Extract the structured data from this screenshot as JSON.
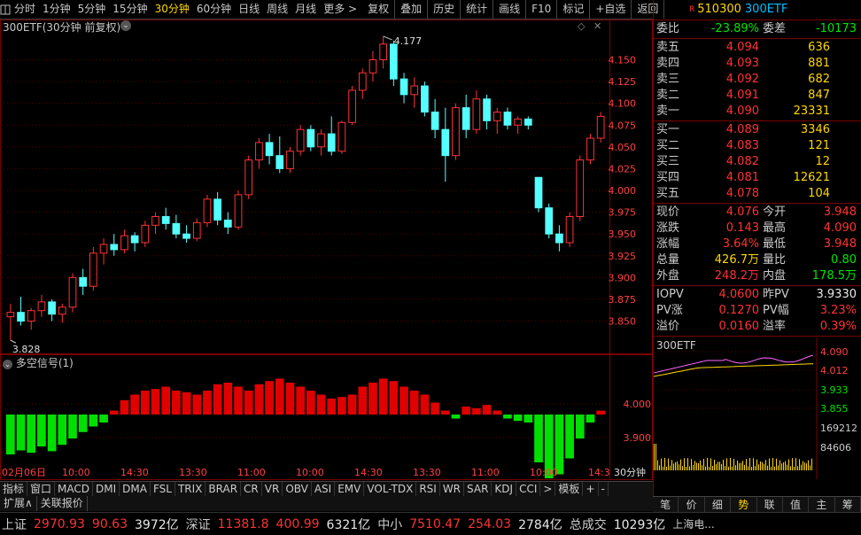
{
  "toolbar": {
    "periods": [
      "分时",
      "1分钟",
      "5分钟",
      "15分钟",
      "30分钟",
      "60分钟",
      "日线",
      "周线",
      "月线",
      "更多 >"
    ],
    "active_period": "30分钟",
    "tools": [
      "复权",
      "叠加",
      "历史",
      "统计",
      "画线",
      "F10",
      "标记",
      "+自选",
      "返回"
    ]
  },
  "chart": {
    "title": "300ETF(30分钟 前复权)",
    "high_label": "4.177",
    "low_label": "3.828",
    "price_ticks": [
      "4.150",
      "4.125",
      "4.100",
      "4.075",
      "4.050",
      "4.025",
      "4.000",
      "3.975",
      "3.950",
      "3.925",
      "3.900",
      "3.875",
      "3.850"
    ],
    "indicator_title": "多空信号(1)",
    "indicator_ticks": [
      "4.000",
      "3.900"
    ],
    "time_labels": [
      "02月06日",
      "10:00",
      "14:30",
      "13:30",
      "11:00",
      "10:00",
      "14:30",
      "13:30",
      "11:00",
      "10:00",
      "14:3"
    ],
    "period_label": "30分钟"
  },
  "quote": {
    "code": "510300",
    "name": "300ETF",
    "wei_bi_label": "委比",
    "wei_bi": "-23.89%",
    "wei_cha_label": "委差",
    "wei_cha": "-10173",
    "asks": [
      {
        "label": "卖五",
        "price": "4.094",
        "vol": "636"
      },
      {
        "label": "卖四",
        "price": "4.093",
        "vol": "881"
      },
      {
        "label": "卖三",
        "price": "4.092",
        "vol": "682"
      },
      {
        "label": "卖二",
        "price": "4.091",
        "vol": "847"
      },
      {
        "label": "卖一",
        "price": "4.090",
        "vol": "23331"
      }
    ],
    "bids": [
      {
        "label": "买一",
        "price": "4.089",
        "vol": "3346"
      },
      {
        "label": "买二",
        "price": "4.083",
        "vol": "121"
      },
      {
        "label": "买三",
        "price": "4.082",
        "vol": "12"
      },
      {
        "label": "买四",
        "price": "4.081",
        "vol": "12621"
      },
      {
        "label": "买五",
        "price": "4.078",
        "vol": "104"
      }
    ],
    "stats": [
      {
        "l1": "现价",
        "v1": "4.076",
        "l2": "今开",
        "v2": "3.948"
      },
      {
        "l1": "涨跌",
        "v1": "0.143",
        "l2": "最高",
        "v2": "4.090"
      },
      {
        "l1": "涨幅",
        "v1": "3.64%",
        "l2": "最低",
        "v2": "3.948"
      },
      {
        "l1": "总量",
        "v1": "426.7万",
        "l2": "量比",
        "v2": "0.80"
      },
      {
        "l1": "外盘",
        "v1": "248.2万",
        "l2": "内盘",
        "v2": "178.5万"
      }
    ],
    "iopv": [
      {
        "l1": "IOPV",
        "v1": "4.0600",
        "l2": "昨PV",
        "v2": "3.9330"
      },
      {
        "l1": "PV涨",
        "v1": "0.1270",
        "l2": "PV幅",
        "v2": "3.23%"
      },
      {
        "l1": "溢价",
        "v1": "0.0160",
        "l2": "溢率",
        "v2": "0.39%"
      }
    ],
    "mini_title": "300ETF",
    "mini_ticks": [
      "4.090",
      "4.012",
      "3.933",
      "3.855",
      "169212",
      "84606"
    ],
    "tabs": [
      "笔",
      "价",
      "细",
      "势",
      "联",
      "值",
      "主",
      "筹"
    ],
    "active_tab": "势"
  },
  "ind_tabs": [
    "指标",
    "窗口",
    "MACD",
    "DMI",
    "DMA",
    "FSL",
    "TRIX",
    "BRAR",
    "CR",
    "VR",
    "OBV",
    "ASI",
    "EMV",
    "VOL-TDX",
    "RSI",
    "WR",
    "SAR",
    "KDJ",
    "CCI",
    ">",
    "模板",
    "+",
    "-"
  ],
  "ext_tabs": [
    "扩展∧",
    "关联报价"
  ],
  "status": {
    "sh_label": "上证",
    "sh_val": "2970.93",
    "sh_chg": "90.63",
    "sh_amt": "3972亿",
    "sz_label": "深证",
    "sz_val": "11381.8",
    "sz_chg": "400.99",
    "sz_amt": "6321亿",
    "zx_label": "中小",
    "zx_val": "7510.47",
    "zx_chg": "254.03",
    "zx_amt": "2784亿",
    "total_label": "总成交",
    "total_val": "10293亿",
    "extra": "上海电..."
  },
  "chart_data": {
    "type": "candlestick",
    "ohlc": [
      [
        3.855,
        3.87,
        3.828,
        3.86
      ],
      [
        3.86,
        3.878,
        3.845,
        3.85
      ],
      [
        3.85,
        3.865,
        3.84,
        3.862
      ],
      [
        3.862,
        3.88,
        3.855,
        3.872
      ],
      [
        3.872,
        3.875,
        3.85,
        3.858
      ],
      [
        3.858,
        3.87,
        3.848,
        3.866
      ],
      [
        3.866,
        3.905,
        3.86,
        3.9
      ],
      [
        3.9,
        3.91,
        3.88,
        3.89
      ],
      [
        3.89,
        3.935,
        3.885,
        3.928
      ],
      [
        3.928,
        3.945,
        3.915,
        3.938
      ],
      [
        3.938,
        3.95,
        3.925,
        3.932
      ],
      [
        3.932,
        3.955,
        3.928,
        3.948
      ],
      [
        3.948,
        3.952,
        3.93,
        3.94
      ],
      [
        3.94,
        3.965,
        3.935,
        3.96
      ],
      [
        3.96,
        3.975,
        3.95,
        3.97
      ],
      [
        3.97,
        3.98,
        3.955,
        3.962
      ],
      [
        3.962,
        3.972,
        3.945,
        3.95
      ],
      [
        3.95,
        3.96,
        3.94,
        3.945
      ],
      [
        3.945,
        3.968,
        3.942,
        3.963
      ],
      [
        3.963,
        3.995,
        3.958,
        3.99
      ],
      [
        3.99,
        3.998,
        3.96,
        3.966
      ],
      [
        3.966,
        3.975,
        3.95,
        3.958
      ],
      [
        3.958,
        4.0,
        3.955,
        3.995
      ],
      [
        3.995,
        4.04,
        3.99,
        4.035
      ],
      [
        4.035,
        4.06,
        4.025,
        4.055
      ],
      [
        4.055,
        4.065,
        4.03,
        4.04
      ],
      [
        4.04,
        4.062,
        4.02,
        4.025
      ],
      [
        4.025,
        4.05,
        4.02,
        4.045
      ],
      [
        4.045,
        4.075,
        4.04,
        4.07
      ],
      [
        4.07,
        4.075,
        4.045,
        4.05
      ],
      [
        4.05,
        4.07,
        4.04,
        4.065
      ],
      [
        4.065,
        4.085,
        4.04,
        4.045
      ],
      [
        4.045,
        4.08,
        4.042,
        4.078
      ],
      [
        4.078,
        4.12,
        4.075,
        4.115
      ],
      [
        4.115,
        4.14,
        4.105,
        4.135
      ],
      [
        4.135,
        4.16,
        4.125,
        4.15
      ],
      [
        4.15,
        4.177,
        4.14,
        4.168
      ],
      [
        4.168,
        4.172,
        4.12,
        4.128
      ],
      [
        4.128,
        4.135,
        4.1,
        4.11
      ],
      [
        4.11,
        4.13,
        4.095,
        4.12
      ],
      [
        4.12,
        4.125,
        4.085,
        4.09
      ],
      [
        4.09,
        4.105,
        4.06,
        4.07
      ],
      [
        4.07,
        4.095,
        4.01,
        4.04
      ],
      [
        4.04,
        4.1,
        4.035,
        4.095
      ],
      [
        4.095,
        4.11,
        4.06,
        4.07
      ],
      [
        4.07,
        4.115,
        4.065,
        4.105
      ],
      [
        4.105,
        4.11,
        4.07,
        4.08
      ],
      [
        4.08,
        4.095,
        4.065,
        4.09
      ],
      [
        4.09,
        4.095,
        4.07,
        4.075
      ],
      [
        4.075,
        4.085,
        4.065,
        4.082
      ],
      [
        4.082,
        4.085,
        4.07,
        4.075
      ],
      [
        4.015,
        4.015,
        3.975,
        3.98
      ],
      [
        3.98,
        3.985,
        3.945,
        3.95
      ],
      [
        3.95,
        3.96,
        3.93,
        3.94
      ],
      [
        3.94,
        3.975,
        3.935,
        3.97
      ],
      [
        3.97,
        4.04,
        3.965,
        4.035
      ],
      [
        4.035,
        4.065,
        4.03,
        4.06
      ],
      [
        4.06,
        4.09,
        4.055,
        4.085
      ]
    ],
    "indicator": [
      -50,
      -45,
      -48,
      -40,
      -46,
      -38,
      -30,
      -22,
      -15,
      -10,
      5,
      18,
      25,
      30,
      32,
      35,
      30,
      28,
      25,
      30,
      38,
      40,
      35,
      30,
      38,
      42,
      45,
      40,
      35,
      30,
      25,
      20,
      22,
      25,
      35,
      40,
      45,
      42,
      35,
      30,
      25,
      15,
      5,
      -5,
      10,
      8,
      12,
      5,
      -5,
      -8,
      -10,
      -60,
      -80,
      -75,
      -55,
      -30,
      -10,
      5
    ],
    "ylim": [
      3.82,
      4.18
    ]
  }
}
